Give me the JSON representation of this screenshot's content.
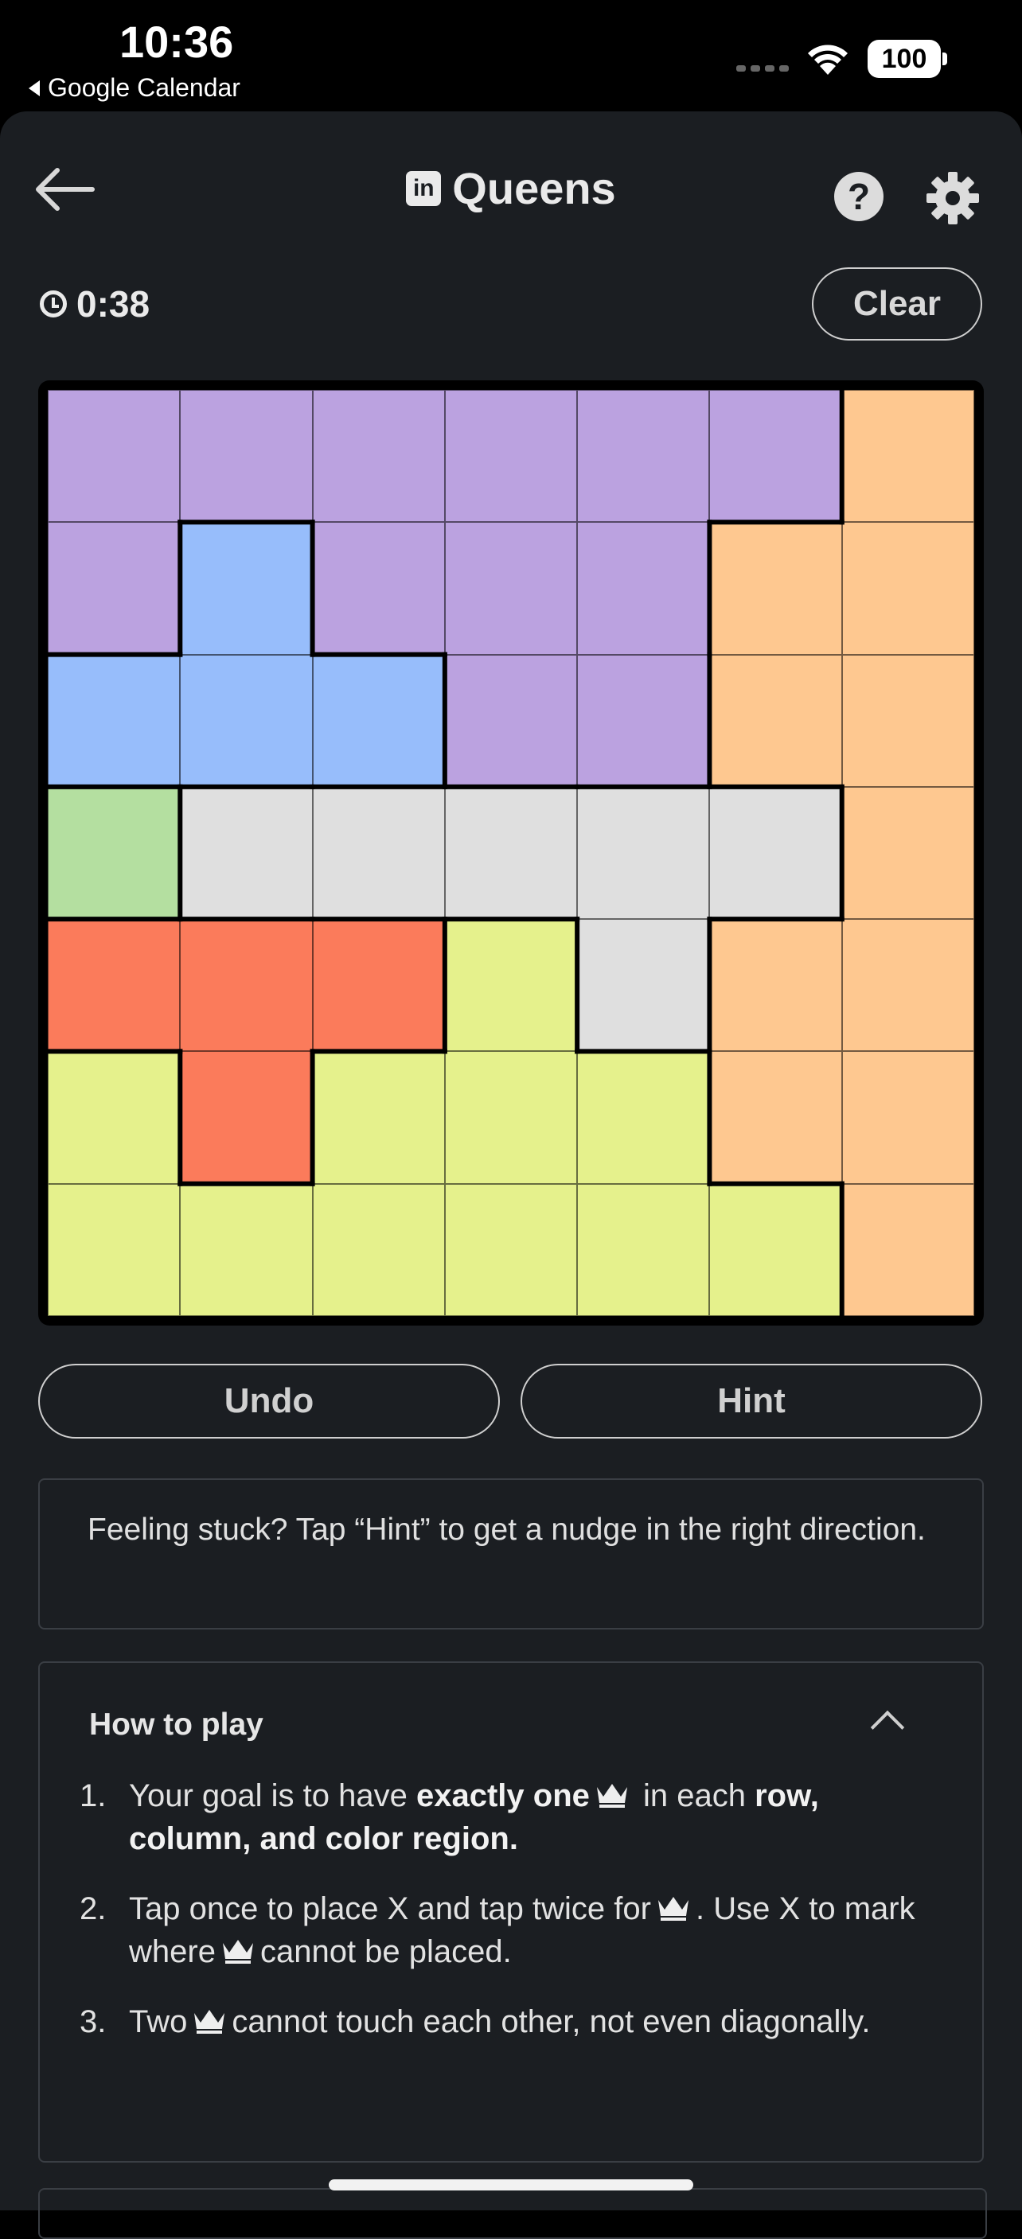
{
  "status_bar": {
    "time": "10:36",
    "back_app": "Google Calendar",
    "battery": "100"
  },
  "header": {
    "title": "Queens",
    "logo_text": "in"
  },
  "timer": {
    "value": "0:38"
  },
  "buttons": {
    "clear": "Clear",
    "undo": "Undo",
    "hint": "Hint"
  },
  "hint_message": "Feeling stuck? Tap “Hint” to get a nudge in the right direction.",
  "how_to_play": {
    "title": "How to play",
    "rules": [
      {
        "num": "1.",
        "parts": [
          "Your goal is to have ",
          "exactly one",
          " in each ",
          "row, column, and color region."
        ]
      },
      {
        "num": "2.",
        "parts": [
          "Tap once to place X and tap twice for",
          ". Use X to mark where",
          "cannot be placed."
        ]
      },
      {
        "num": "3.",
        "parts": [
          "Two",
          "cannot touch each other, not even diagonally."
        ]
      }
    ]
  },
  "board": {
    "colors": {
      "P": "#bba2e0",
      "O": "#fec890",
      "B": "#97bdfb",
      "G": "#b4dfa0",
      "W": "#dfdfdf",
      "R": "#fb7b5b",
      "Y": "#e5f18c"
    },
    "grid": [
      "PPPPPPO",
      "PBPPPOO",
      "BBBPPOO",
      "GWWWWWO",
      "RRRYWOO",
      "YRYYYOO",
      "YYYYYYO"
    ]
  }
}
